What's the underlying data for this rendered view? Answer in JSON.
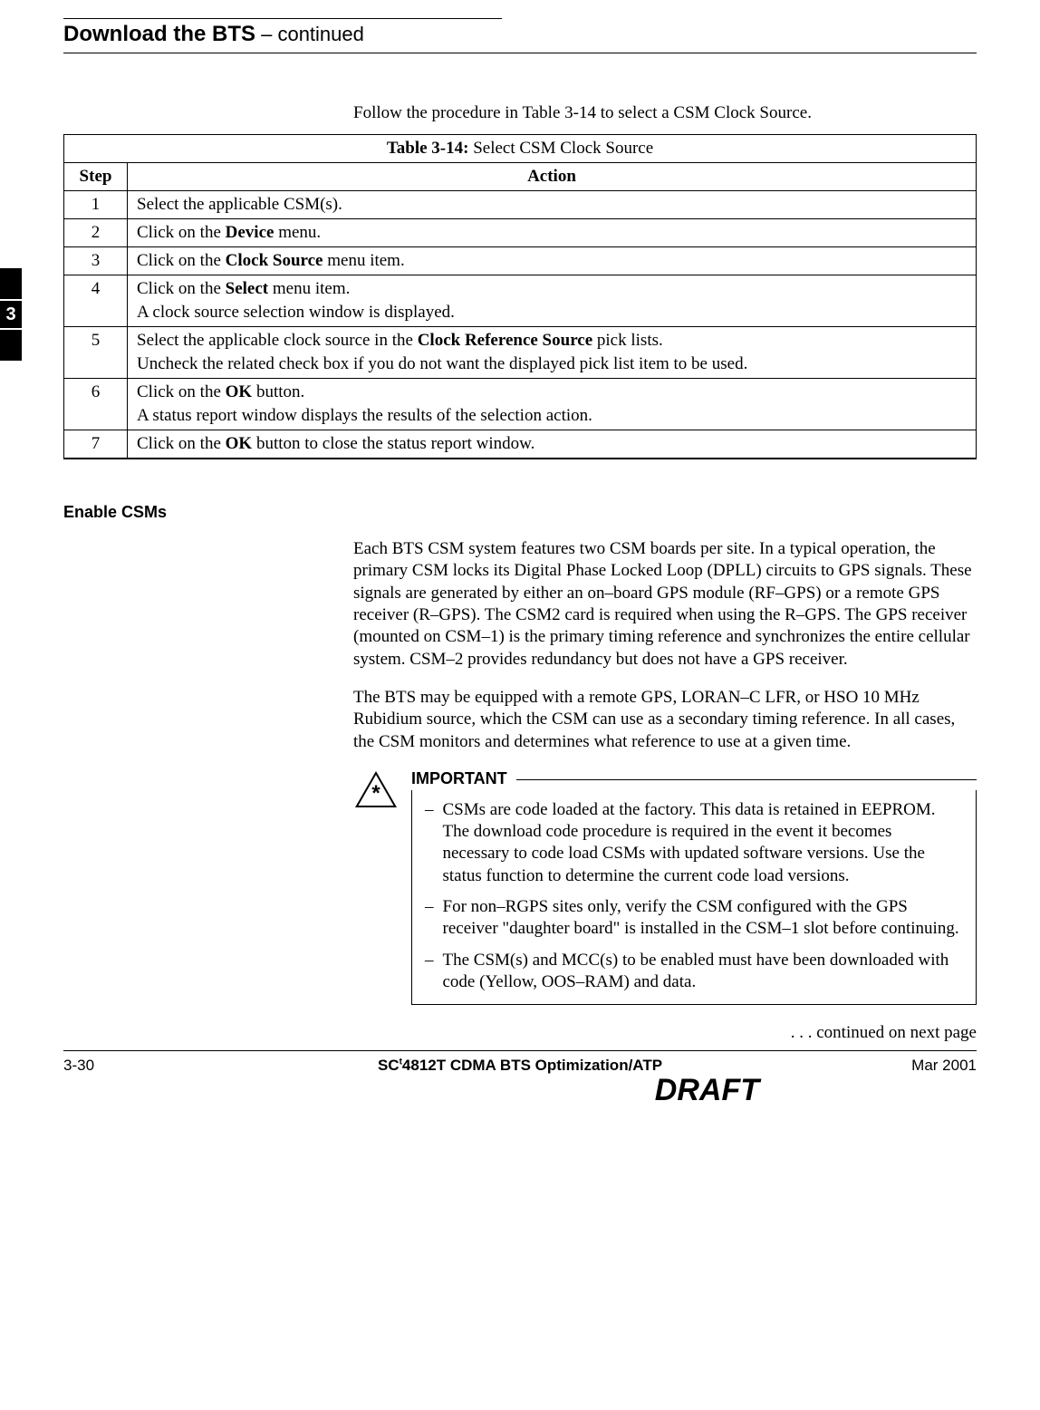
{
  "header": {
    "title": "Download the BTS",
    "suffix": " – continued"
  },
  "intro": "Follow the procedure in Table 3-14 to select a CSM Clock Source.",
  "table": {
    "caption_prefix": "Table 3-14: ",
    "caption": "Select CSM Clock Source",
    "head_step": "Step",
    "head_action": "Action",
    "rows": [
      {
        "step": "1",
        "lines": [
          [
            {
              "t": "Select the applicable CSM(s)."
            }
          ]
        ]
      },
      {
        "step": "2",
        "lines": [
          [
            {
              "t": "Click on the "
            },
            {
              "b": "Device"
            },
            {
              "t": " menu."
            }
          ]
        ]
      },
      {
        "step": "3",
        "lines": [
          [
            {
              "t": "Click on the "
            },
            {
              "b": "Clock Source"
            },
            {
              "t": " menu item."
            }
          ]
        ]
      },
      {
        "step": "4",
        "lines": [
          [
            {
              "t": "Click on the "
            },
            {
              "b": "Select"
            },
            {
              "t": " menu item."
            }
          ],
          [
            {
              "t": "A clock source selection window is displayed."
            }
          ]
        ]
      },
      {
        "step": "5",
        "lines": [
          [
            {
              "t": "Select the applicable clock source in the "
            },
            {
              "b": "Clock Reference Source"
            },
            {
              "t": " pick lists."
            }
          ],
          [
            {
              "t": "Uncheck the related check box if you do not want the displayed pick list item to be used."
            }
          ]
        ]
      },
      {
        "step": "6",
        "lines": [
          [
            {
              "t": "Click on the "
            },
            {
              "b": "OK"
            },
            {
              "t": " button."
            }
          ],
          [
            {
              "t": "A status report window displays the results of the selection action."
            }
          ]
        ]
      },
      {
        "step": "7",
        "lines": [
          [
            {
              "t": "Click on the "
            },
            {
              "b": "OK"
            },
            {
              "t": " button to close the status report window."
            }
          ]
        ]
      }
    ]
  },
  "section": {
    "title": "Enable CSMs",
    "para1": "Each BTS CSM system features two CSM boards per site. In a typical operation, the primary CSM locks its Digital Phase Locked Loop (DPLL) circuits to GPS signals. These signals are generated by either an on–board GPS module (RF–GPS) or a remote GPS receiver (R–GPS). The CSM2 card is required when using the R–GPS. The GPS receiver (mounted on CSM–1) is the primary timing reference and synchronizes the entire cellular system. CSM–2 provides redundancy but does not have a GPS receiver.",
    "para2": "The BTS may be equipped with a remote GPS, LORAN–C LFR, or HSO 10 MHz Rubidium source, which the CSM can use as a secondary timing reference. In all cases, the CSM monitors and determines what reference to use at a given time."
  },
  "important": {
    "label": "IMPORTANT",
    "items": [
      "CSMs are code loaded at the factory. This data is retained in EEPROM. The download code procedure is required in the event it becomes necessary to code load CSMs with updated software versions. Use the status function to determine the current code load versions.",
      "For non–RGPS sites only, verify the CSM configured with the GPS receiver \"daughter board\" is installed in the CSM–1 slot before continuing.",
      "The CSM(s) and MCC(s) to be enabled must have been downloaded with code (Yellow, OOS–RAM) and data."
    ]
  },
  "continued": ". . . continued on next page",
  "footer": {
    "page": "3-30",
    "center_prefix": "SC",
    "center_tm": "t",
    "center_suffix": "4812T CDMA BTS Optimization/ATP",
    "date": "Mar 2001"
  },
  "draft": "DRAFT",
  "sidetab": "3"
}
